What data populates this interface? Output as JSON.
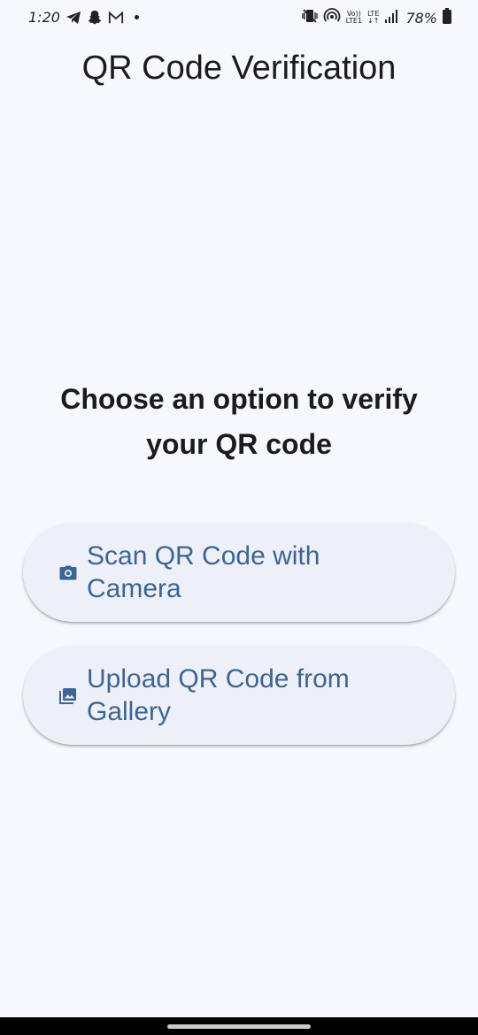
{
  "status_bar": {
    "time": "1:20",
    "battery": "78%",
    "volte": "Vo))",
    "lte1": "LTE1",
    "lte": "LTE",
    "updown": "↓↑"
  },
  "header": {
    "title": "QR Code Verification"
  },
  "main": {
    "prompt": "Choose an option to verify your QR code",
    "buttons": [
      {
        "label": "Scan QR Code with Camera",
        "icon": "camera-icon"
      },
      {
        "label": "Upload QR Code from Gallery",
        "icon": "gallery-icon"
      }
    ]
  },
  "colors": {
    "background": "#f7f8fd",
    "button_bg": "#eef0f8",
    "accent": "#3d6591",
    "text": "#1b1b1f"
  }
}
